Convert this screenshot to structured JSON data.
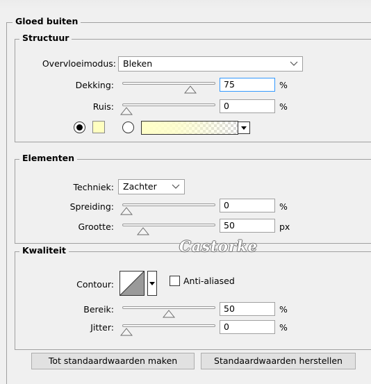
{
  "panel": {
    "title": "Gloed buiten"
  },
  "structure": {
    "legend": "Structuur",
    "blend_mode_label": "Overvloeimodus:",
    "blend_mode_value": "Bleken",
    "opacity_label": "Dekking:",
    "opacity_value": "75",
    "opacity_unit": "%",
    "opacity_level": 0.75,
    "noise_label": "Ruis:",
    "noise_value": "0",
    "noise_unit": "%",
    "noise_level": 0,
    "swatch_color": "#ffffc0"
  },
  "elements": {
    "legend": "Elementen",
    "technique_label": "Techniek:",
    "technique_value": "Zachter",
    "spread_label": "Spreiding:",
    "spread_value": "0",
    "spread_unit": "%",
    "spread_level": 0,
    "size_label": "Grootte:",
    "size_value": "50",
    "size_unit": "px",
    "size_level": 0.2
  },
  "quality": {
    "legend": "Kwaliteit",
    "watermark": "Castorke",
    "contour_label": "Contour:",
    "anti_aliased_label": "Anti-aliased",
    "range_label": "Bereik:",
    "range_value": "50",
    "range_unit": "%",
    "range_level": 0.5,
    "jitter_label": "Jitter:",
    "jitter_value": "0",
    "jitter_unit": "%",
    "jitter_level": 0
  },
  "buttons": {
    "make_default": "Tot standaardwaarden maken",
    "reset_default": "Standaardwaarden herstellen"
  }
}
